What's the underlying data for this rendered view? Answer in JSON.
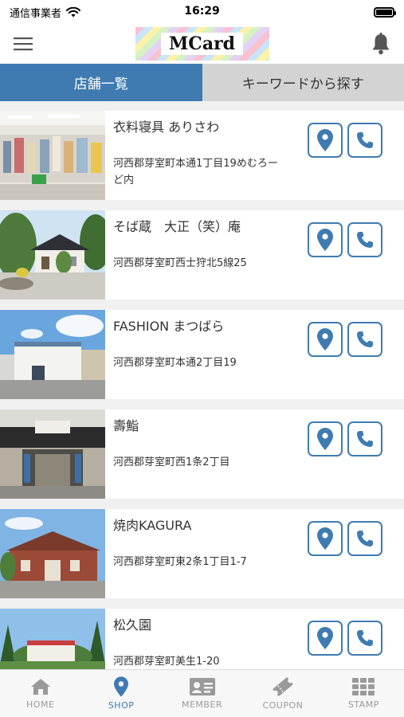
{
  "status": {
    "carrier": "通信事業者",
    "time": "16:29"
  },
  "header": {
    "logo_text": "MCard"
  },
  "tabs": [
    {
      "label": "店舗一覧",
      "active": true
    },
    {
      "label": "キーワードから探す",
      "active": false
    }
  ],
  "shops": [
    {
      "name": "衣料寝具 ありさわ",
      "address": "河西郡芽室町本通1丁目19めむろーど内"
    },
    {
      "name": "そば蔵　大正（笑）庵",
      "address": "河西郡芽室町西士狩北5線25"
    },
    {
      "name": "FASHION まつばら",
      "address": "河西郡芽室町本通2丁目19"
    },
    {
      "name": "壽鮨",
      "address": "河西郡芽室町西1条2丁目"
    },
    {
      "name": "焼肉KAGURA",
      "address": "河西郡芽室町東2条1丁目1-7"
    },
    {
      "name": "松久園",
      "address": "河西郡芽室町美生1-20"
    }
  ],
  "bottom_nav": [
    {
      "label": "HOME",
      "icon": "home-icon",
      "active": false
    },
    {
      "label": "SHOP",
      "icon": "map-pin-icon",
      "active": true
    },
    {
      "label": "MEMBER",
      "icon": "member-card-icon",
      "active": false
    },
    {
      "label": "COUPON",
      "icon": "coupon-ticket-icon",
      "active": false
    },
    {
      "label": "STAMP",
      "icon": "stamp-grid-icon",
      "active": false
    }
  ],
  "colors": {
    "accent": "#3f7bb1",
    "inactive_tab": "#d3d3d3",
    "list_background": "#f0f0f0"
  }
}
